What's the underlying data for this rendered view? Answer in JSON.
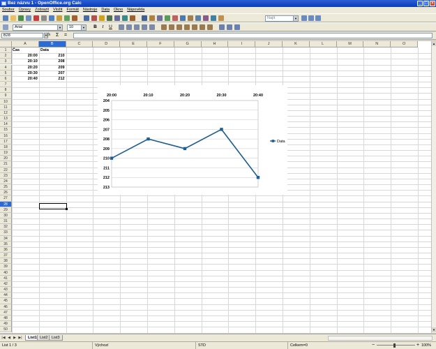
{
  "window": {
    "title": "Bez názvu 1 - OpenOffice.org Calc"
  },
  "menu": [
    "Soubor",
    "Úpravy",
    "Zobrazit",
    "Vložit",
    "Formát",
    "Nástroje",
    "Data",
    "Okno",
    "Nápověda"
  ],
  "toolbar": {
    "find_placeholder": "Najít",
    "font_name": "Arial",
    "font_size": "10",
    "bold_label": "B",
    "italic_label": "I",
    "underline_label": "U"
  },
  "formula_bar": {
    "cell_ref": "B28",
    "fx_label": "fx",
    "sum_label": "Σ",
    "eq_label": "=",
    "content": ""
  },
  "grid": {
    "columns": [
      "A",
      "B",
      "C",
      "D",
      "E",
      "F",
      "G",
      "H",
      "I",
      "J",
      "K",
      "L",
      "M",
      "N",
      "O"
    ],
    "selected_column": "B",
    "selected_row": 28,
    "row_count": 50,
    "headers": {
      "a1": "Čas",
      "b1": "Data"
    },
    "rows": [
      {
        "time": "20:00",
        "value": "210"
      },
      {
        "time": "20:10",
        "value": "208"
      },
      {
        "time": "20:20",
        "value": "209"
      },
      {
        "time": "20:30",
        "value": "207"
      },
      {
        "time": "20:40",
        "value": "212"
      }
    ]
  },
  "chart_data": {
    "type": "line",
    "categories": [
      "20:00",
      "20:10",
      "20:20",
      "20:30",
      "20:40"
    ],
    "series": [
      {
        "name": "Data",
        "values": [
          210,
          208,
          209,
          207,
          212
        ],
        "color": "#1f5f8f"
      }
    ],
    "y_ticks": [
      "204",
      "205",
      "206",
      "207",
      "208",
      "209",
      "210",
      "211",
      "212",
      "213"
    ],
    "ylim": [
      204,
      213
    ],
    "y_axis_reversed": true,
    "x_axis_position": "top",
    "legend_position": "right",
    "grid": true
  },
  "sheets": [
    "List1",
    "List2",
    "List3"
  ],
  "active_sheet": "List1",
  "status": {
    "sheet_info": "List 1 / 3",
    "page_style": "Výchozí",
    "mode": "STD",
    "sum": "Celkem=0",
    "zoom": "100%"
  }
}
